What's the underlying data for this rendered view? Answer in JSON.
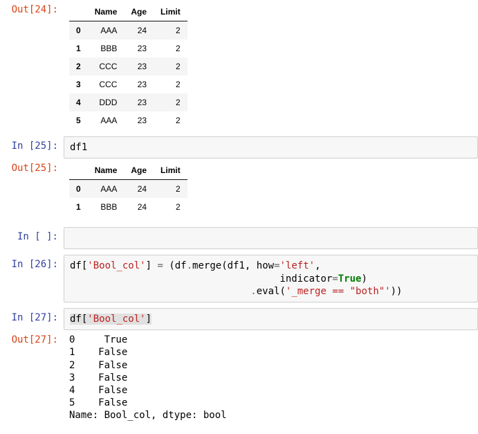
{
  "cells": {
    "out24": {
      "prompt": "Out[24]:"
    },
    "in25": {
      "prompt": "In [25]:",
      "code_plain": "df1"
    },
    "out25": {
      "prompt": "Out[25]:"
    },
    "inBlank": {
      "prompt": "In [ ]:"
    },
    "in26": {
      "prompt": "In [26]:"
    },
    "in27": {
      "prompt": "In [27]:"
    },
    "out27": {
      "prompt": "Out[27]:"
    }
  },
  "code26": {
    "p1": "df[",
    "s1": "'Bool_col'",
    "p2": "] ",
    "op1": "=",
    "p3": " (df",
    "op2": ".",
    "p4": "merge(df1, how",
    "op3": "=",
    "s2": "'left'",
    "p5": ",",
    "indent2": "                                    ",
    "p6": "indicator",
    "op4": "=",
    "kw1": "True",
    "p7": ")",
    "indent3": "                               ",
    "op5": ".",
    "p8": "eval(",
    "s3": "'_merge == \"both\"'",
    "p9": "))"
  },
  "code27": {
    "p1": "df[",
    "s1": "'Bool_col'",
    "p2": "]"
  },
  "table24": {
    "columns": [
      "",
      "Name",
      "Age",
      "Limit"
    ],
    "rows": [
      [
        "0",
        "AAA",
        "24",
        "2"
      ],
      [
        "1",
        "BBB",
        "23",
        "2"
      ],
      [
        "2",
        "CCC",
        "23",
        "2"
      ],
      [
        "3",
        "CCC",
        "23",
        "2"
      ],
      [
        "4",
        "DDD",
        "23",
        "2"
      ],
      [
        "5",
        "AAA",
        "23",
        "2"
      ]
    ]
  },
  "table25": {
    "columns": [
      "",
      "Name",
      "Age",
      "Limit"
    ],
    "rows": [
      [
        "0",
        "AAA",
        "24",
        "2"
      ],
      [
        "1",
        "BBB",
        "24",
        "2"
      ]
    ]
  },
  "out27_text": "0     True\n1    False\n2    False\n3    False\n4    False\n5    False\nName: Bool_col, dtype: bool"
}
